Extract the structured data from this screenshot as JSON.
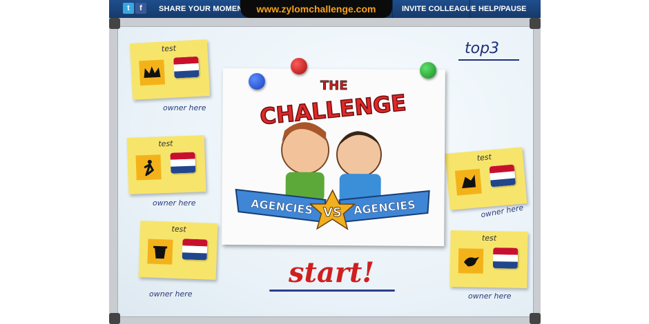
{
  "topbar": {
    "share_label": "SHARE YOUR MOMENTS",
    "url": "www.zylomchallenge.com",
    "invite_label": "INVITE COLLEAGUE",
    "help_label": "HELP/PAUSE",
    "twitter_glyph": "t",
    "facebook_glyph": "f"
  },
  "top3": {
    "label": "top3"
  },
  "start": {
    "label": "start!"
  },
  "poster": {
    "line1": "THE",
    "line2": "CHALLENGE",
    "left_banner": "AGENCIES",
    "vs": "VS",
    "right_banner": "AGENCIES"
  },
  "notes": [
    {
      "title": "test",
      "owner": "owner here"
    },
    {
      "title": "test",
      "owner": "owner here"
    },
    {
      "title": "test",
      "owner": "owner here"
    },
    {
      "title": "test",
      "owner": "owner here"
    },
    {
      "title": "test",
      "owner": "owner here"
    }
  ],
  "colors": {
    "topbar": "#1e4e8c",
    "url": "#f7a21b",
    "start": "#cf1f1f",
    "ink": "#2b3a7a",
    "note": "#f7e56b"
  },
  "icons": [
    "crown-icon",
    "runner-icon",
    "bucket-icon",
    "tree-icon",
    "bird-icon"
  ]
}
